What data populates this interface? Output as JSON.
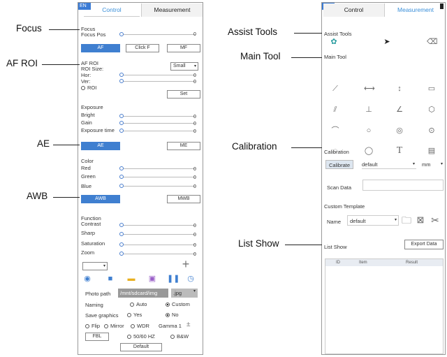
{
  "callouts": {
    "focus": "Focus",
    "af_roi": "AF ROI",
    "ae": "AE",
    "awb": "AWB",
    "assist_tools": "Assist Tools",
    "main_tool": "Main Tool",
    "calibration": "Calibration",
    "list_show": "List Show"
  },
  "left": {
    "lang": "EN",
    "tab_control": "Control",
    "tab_measurement": "Measurement",
    "focus": {
      "title": "Focus",
      "pos_label": "Focus Pos",
      "pos_value": "0",
      "af": "AF",
      "clickf": "Click F",
      "mf": "MF"
    },
    "afroi": {
      "title": "AF ROI",
      "size_label": "ROI Size:",
      "size_value": "Small",
      "hor": "Hor:",
      "ver": "Ver:",
      "hor_value": "0",
      "ver_value": "0",
      "roi": "ROI",
      "set": "Set"
    },
    "exposure": {
      "title": "Exposure",
      "bright": "Bright",
      "gain": "Gain",
      "time": "Exposure time",
      "bright_value": "0",
      "gain_value": "0",
      "time_value": "0",
      "ae": "AE",
      "me": "ME"
    },
    "color": {
      "title": "Color",
      "red": "Red",
      "green": "Green",
      "blue": "Blue",
      "red_value": "0",
      "green_value": "0",
      "blue_value": "0",
      "awb": "AWB",
      "mwb": "MWB"
    },
    "function": {
      "title": "Function",
      "contrast": "Contrast",
      "sharp": "Sharp",
      "saturation": "Saturation",
      "zoom": "Zoom",
      "contrast_value": "0",
      "sharp_value": "0",
      "saturation_value": "0",
      "zoom_value": "0"
    },
    "photo_path_label": "Photo path",
    "photo_path_value": "/mnt/sdcard/img",
    "photo_ext": ".jpg",
    "naming_label": "Naming",
    "naming_auto": "Auto",
    "naming_custom": "Custom",
    "save_graphics_label": "Save graphics",
    "save_yes": "Yes",
    "save_no": "No",
    "flip": "Flip",
    "mirror": "Mirror",
    "wdr": "WDR",
    "gamma": "Gamma 1",
    "fbl": "FBL",
    "hz": "50/60 HZ",
    "bw": "B&W",
    "default_btn": "Default"
  },
  "right": {
    "lang": "EN",
    "tab_control": "Control",
    "tab_measurement": "Measurement",
    "assist_title": "Assist Tools",
    "main_title": "Main Tool",
    "calibration_title": "Calibration",
    "calibrate_btn": "Calibrate",
    "calib_select": "default",
    "unit": "mm",
    "scan_data": "Scan Data",
    "custom_template_title": "Custom Template",
    "name_label": "Name",
    "name_value": "default",
    "list_show_title": "List Show",
    "export_btn": "Export Data",
    "columns": [
      "ID",
      "Item",
      "Result"
    ]
  },
  "colors": {
    "accent": "#3f7fd0",
    "tab_active": "#3a8fd9"
  }
}
